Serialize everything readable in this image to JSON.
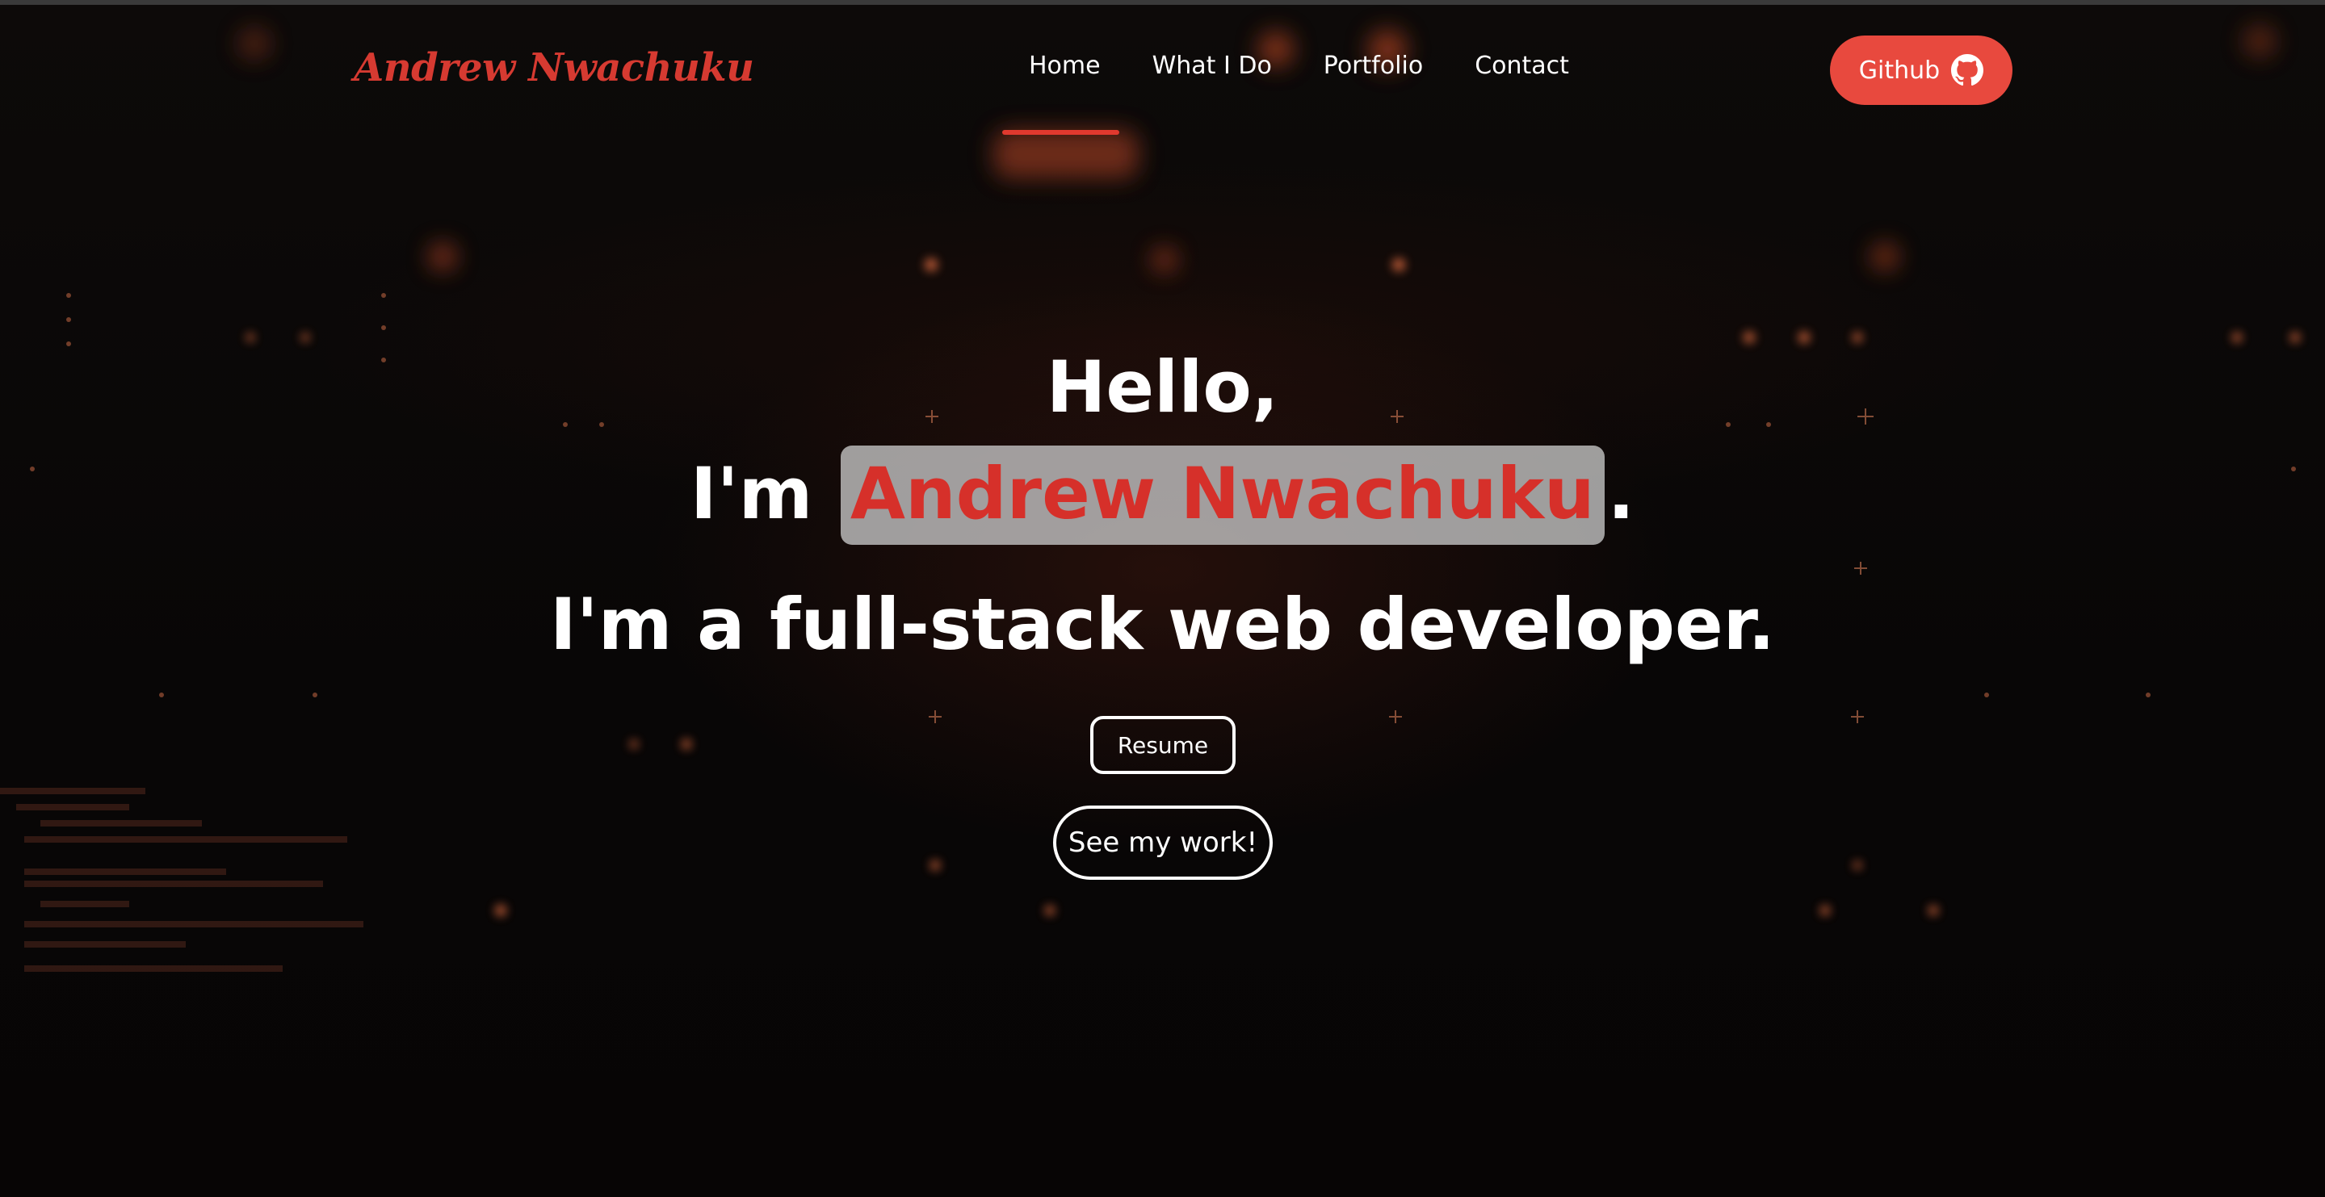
{
  "header": {
    "brand": "Andrew Nwachuku",
    "nav": [
      {
        "label": "Home",
        "active": true
      },
      {
        "label": "What I Do"
      },
      {
        "label": "Portfolio"
      },
      {
        "label": "Contact"
      }
    ],
    "github_label": "Github",
    "github_icon": "github-icon"
  },
  "hero": {
    "line1": "Hello,",
    "line2_prefix": "I'm",
    "name": "Andrew Nwachuku",
    "line2_suffix": ".",
    "line3": "I'm a full-stack web developer.",
    "resume_label": "Resume",
    "work_label": "See my work!"
  },
  "colors": {
    "accent": "#e8493e",
    "brand": "#d63a31",
    "background": "#0a0808",
    "highlight_box": "#c8c8c8"
  }
}
